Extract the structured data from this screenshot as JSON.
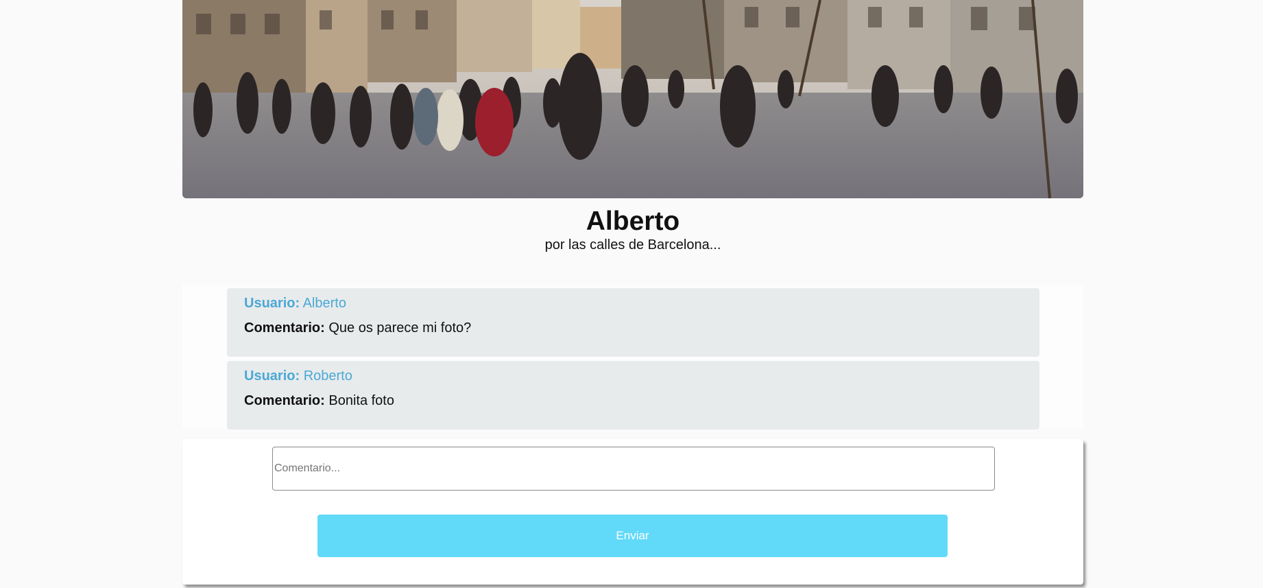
{
  "post": {
    "title": "Alberto",
    "subtitle": "por las calles de Barcelona...",
    "photo_alt": "street-photo"
  },
  "comments": [
    {
      "user_key": "Usuario:",
      "user": "Alberto",
      "comment_key": "Comentario:",
      "comment": "Que os parece mi foto?"
    },
    {
      "user_key": "Usuario:",
      "user": "Roberto",
      "comment_key": "Comentario:",
      "comment": "Bonita foto"
    }
  ],
  "form": {
    "placeholder": "Comentario...",
    "submit_label": "Enviar"
  },
  "colors": {
    "page_bg": "#fafafa",
    "comment_bg": "#e8ebec",
    "user_color": "#4aa8d6",
    "button_bg": "#61d9f9",
    "button_text": "#ffffff"
  }
}
